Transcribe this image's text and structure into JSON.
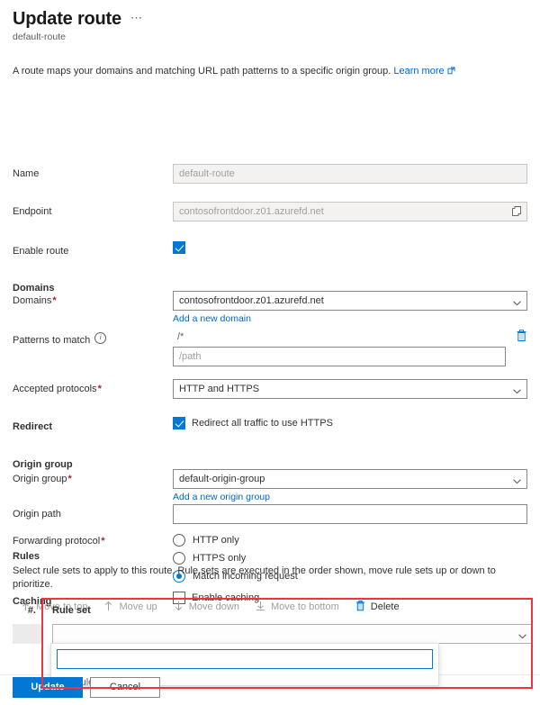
{
  "header": {
    "title": "Update route",
    "more_label": "⋯",
    "subtitle": "default-route",
    "intro_text": "A route maps your domains and matching URL path patterns to a specific origin group.",
    "learn_more_label": "Learn more"
  },
  "form": {
    "name": {
      "label": "Name",
      "value": "default-route",
      "readonly": true
    },
    "endpoint": {
      "label": "Endpoint",
      "value": "contosofrontdoor.z01.azurefd.net",
      "copy_icon": "copy-icon",
      "readonly": true
    },
    "enable_route": {
      "label": "Enable route",
      "checked": true
    },
    "domains_section": {
      "heading": "Domains",
      "label": "Domains",
      "required": true,
      "selected": "contosofrontdoor.z01.azurefd.net",
      "add_link": "Add a new domain"
    },
    "patterns": {
      "label": "Patterns to match",
      "info_icon": "info-icon",
      "existing_value": "/*",
      "delete_icon": "trash-icon",
      "new_placeholder": "/path",
      "new_value": ""
    },
    "accepted_protocols": {
      "label": "Accepted protocols",
      "required": true,
      "selected": "HTTP and HTTPS"
    },
    "redirect": {
      "label": "Redirect",
      "checkbox_label": "Redirect all traffic to use HTTPS",
      "checked": true
    },
    "origin_group_section": {
      "heading": "Origin group",
      "label": "Origin group",
      "required": true,
      "selected": "default-origin-group",
      "add_link": "Add a new origin group"
    },
    "origin_path": {
      "label": "Origin path",
      "value": "",
      "placeholder": ""
    },
    "forwarding_protocol": {
      "label": "Forwarding protocol",
      "required": true,
      "options": [
        {
          "label": "HTTP only",
          "selected": false
        },
        {
          "label": "HTTPS only",
          "selected": false
        },
        {
          "label": "Match incoming request",
          "selected": true
        }
      ]
    },
    "caching": {
      "label": "Caching",
      "checkbox_label": "Enable caching",
      "checked": false
    }
  },
  "rules": {
    "heading": "Rules",
    "description": "Select rule sets to apply to this route. Rule sets are executed in the order shown, move rule sets up or down to prioritize.",
    "commands": [
      {
        "label": "Move to top",
        "icon": "move-to-top-icon",
        "enabled": false
      },
      {
        "label": "Move up",
        "icon": "arrow-up-icon",
        "enabled": false
      },
      {
        "label": "Move down",
        "icon": "arrow-down-icon",
        "enabled": false
      },
      {
        "label": "Move to bottom",
        "icon": "move-to-bottom-icon",
        "enabled": false
      },
      {
        "label": "Delete",
        "icon": "trash-icon",
        "enabled": true
      }
    ],
    "columns": {
      "number": "#.",
      "rule_set": "Rule set"
    },
    "row": {
      "selected_rule_set": ""
    },
    "dropdown": {
      "open": true,
      "search_value": "",
      "options": [
        "myRuleSet"
      ]
    }
  },
  "footer": {
    "update_label": "Update",
    "cancel_label": "Cancel"
  },
  "colors": {
    "accent": "#0078d4",
    "link": "#0066cc",
    "required": "#a4262c",
    "highlight": "#ef3340",
    "disabled_text": "#a19f9d",
    "readonly_bg": "#f3f2f1"
  }
}
